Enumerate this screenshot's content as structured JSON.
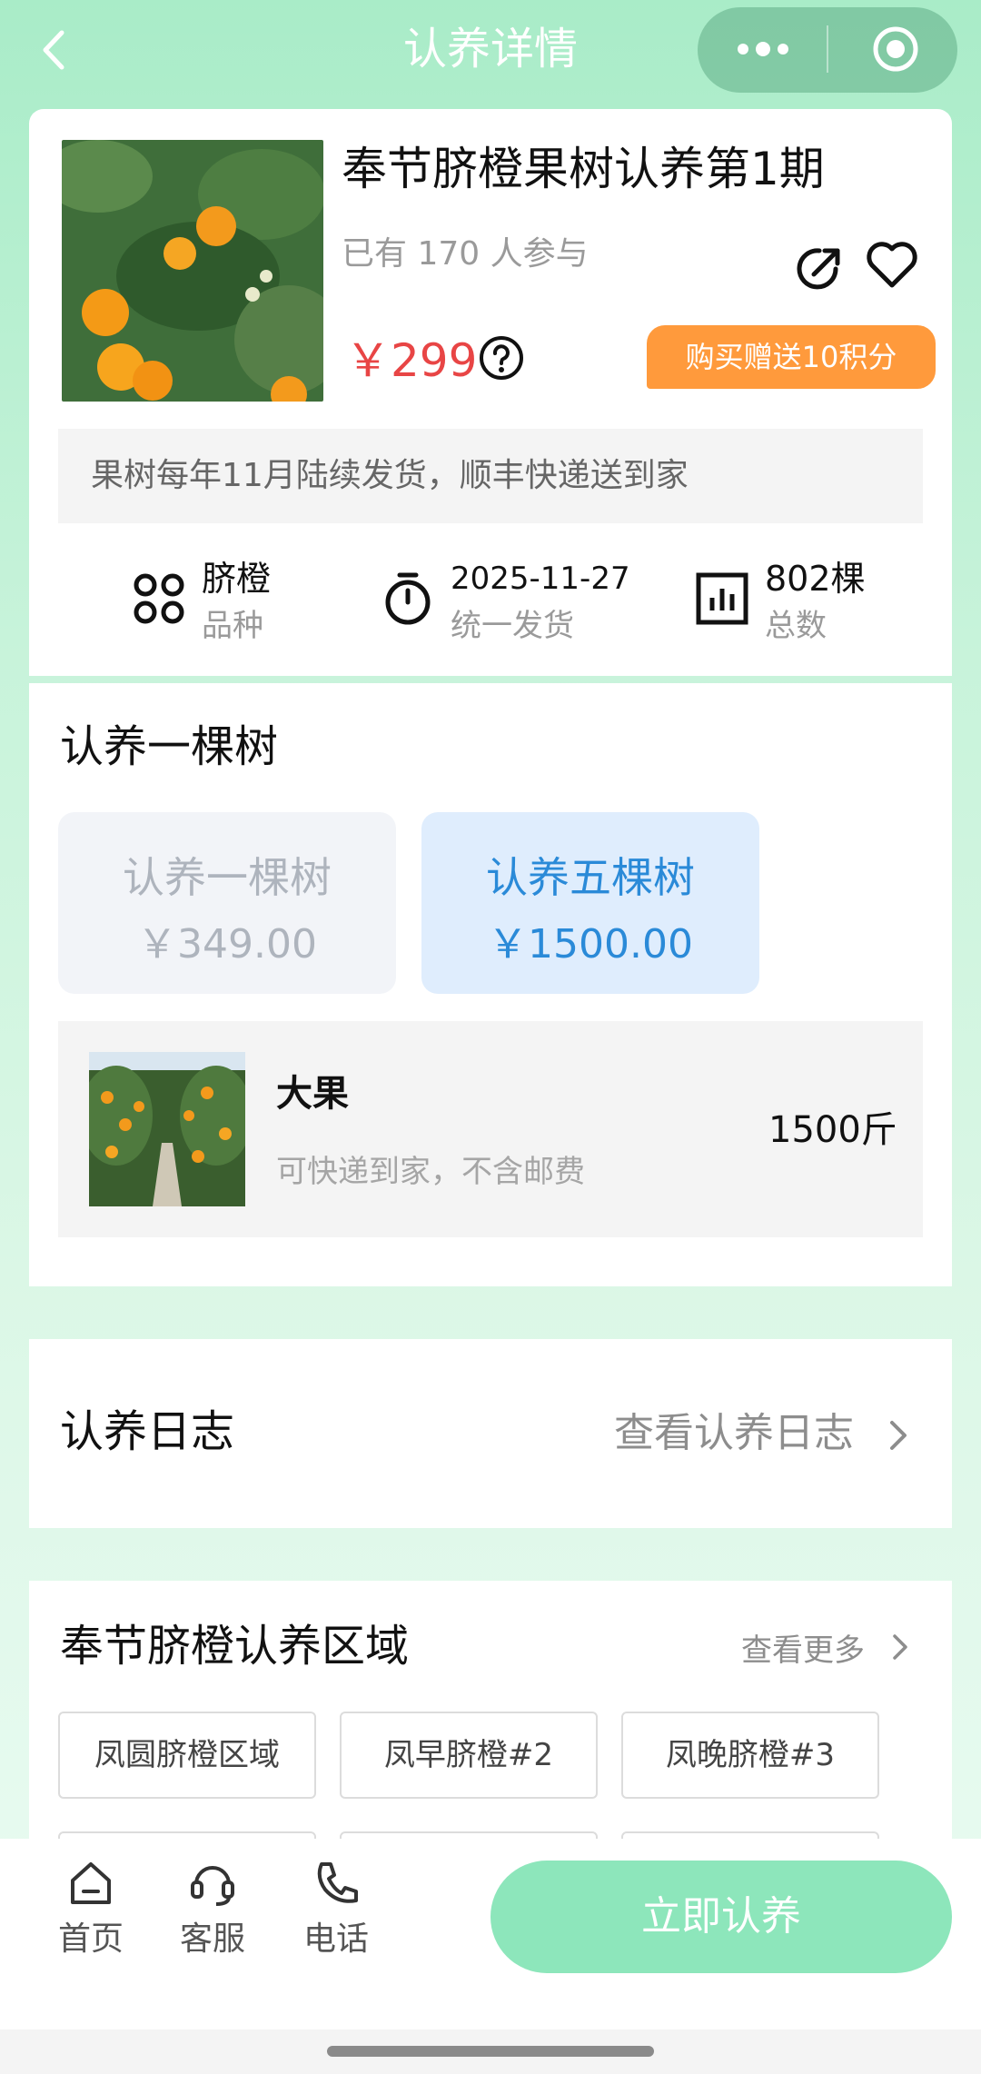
{
  "header": {
    "title": "认养详情"
  },
  "product": {
    "title": "奉节脐橙果树认养第1期",
    "participants": "已有 170 人参与",
    "price": "￥299",
    "promo": "购买赠送10积分",
    "notice": "果树每年11月陆续发货，顺丰快递送到家"
  },
  "stats": [
    {
      "value": "脐橙",
      "label": "品种",
      "icon": "variety-icon"
    },
    {
      "value": "2025-11-27",
      "label": "统一发货",
      "icon": "timer-icon"
    },
    {
      "value": "802棵",
      "label": "总数",
      "icon": "chart-icon"
    }
  ],
  "adopt": {
    "section_title": "认养一棵树",
    "options": [
      {
        "name": "认养一棵树",
        "price": "￥349.00",
        "selected": false
      },
      {
        "name": "认养五棵树",
        "price": "￥1500.00",
        "selected": true
      }
    ],
    "package": {
      "name": "大果",
      "desc": "可快递到家，不含邮费",
      "qty": "1500斤"
    }
  },
  "log": {
    "title": "认养日志",
    "link": "查看认养日志"
  },
  "regions": {
    "title": "奉节脐橙认养区域",
    "more": "查看更多",
    "tags": [
      "凤圆脐橙区域",
      "凤早脐橙#2",
      "凤晚脐橙#3"
    ]
  },
  "bottom_nav": {
    "items": [
      {
        "label": "首页",
        "icon": "home-icon"
      },
      {
        "label": "客服",
        "icon": "headset-icon"
      },
      {
        "label": "电话",
        "icon": "phone-icon"
      }
    ],
    "cta": "立即认养"
  },
  "colors": {
    "accent": "#8de6bb",
    "price": "#e84545",
    "promo": "#ff9a3c",
    "selected": "#2a8ad8"
  }
}
